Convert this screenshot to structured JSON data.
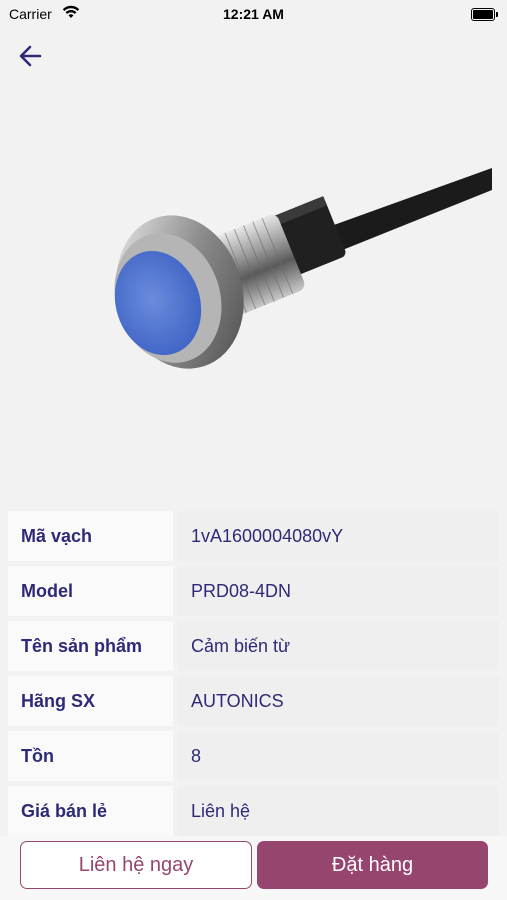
{
  "status_bar": {
    "carrier": "Carrier",
    "time": "12:21 AM"
  },
  "nav": {
    "back_icon": "arrow-left-icon"
  },
  "product": {
    "image_description_icon": "proximity-sensor-image",
    "rows": [
      {
        "label": "Mã vạch",
        "value": "1vA1600004080vY"
      },
      {
        "label": "Model",
        "value": "PRD08-4DN"
      },
      {
        "label": "Tên sản phẩm",
        "value": "Cảm biến từ"
      },
      {
        "label": "Hãng SX",
        "value": "AUTONICS"
      },
      {
        "label": "Tồn",
        "value": "8"
      },
      {
        "label": "Giá bán lẻ",
        "value": "Liên hệ"
      }
    ]
  },
  "actions": {
    "contact_label": "Liên hệ ngay",
    "order_label": "Đặt hàng"
  },
  "colors": {
    "accent": "#96456f",
    "text_primary": "#2e2a78",
    "sensor_face": "#5b7fd6"
  }
}
